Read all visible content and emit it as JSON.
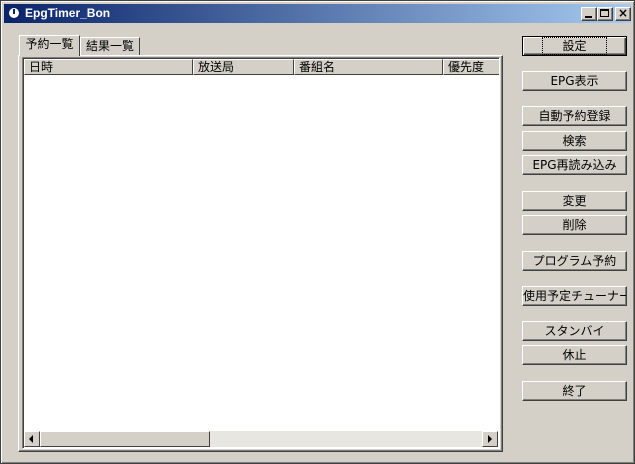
{
  "window": {
    "title": "EpgTimer_Bon"
  },
  "tabs": [
    {
      "label": "予約一覧",
      "active": true
    },
    {
      "label": "結果一覧",
      "active": false
    }
  ],
  "list": {
    "columns": [
      "日時",
      "放送局",
      "番組名",
      "優先度"
    ],
    "rows": []
  },
  "buttons": {
    "settings": "設定",
    "epg_view": "EPG表示",
    "auto_reserve": "自動予約登録",
    "search": "検索",
    "epg_reload": "EPG再読み込み",
    "change": "変更",
    "delete": "削除",
    "program_reserve": "プログラム予約",
    "tuner_usage": "使用予定チューナー",
    "standby": "スタンバイ",
    "hibernate": "休止",
    "exit": "終了"
  },
  "colors": {
    "titlebar_start": "#0a246a",
    "titlebar_end": "#a6caf0",
    "face": "#d4d0c8"
  }
}
